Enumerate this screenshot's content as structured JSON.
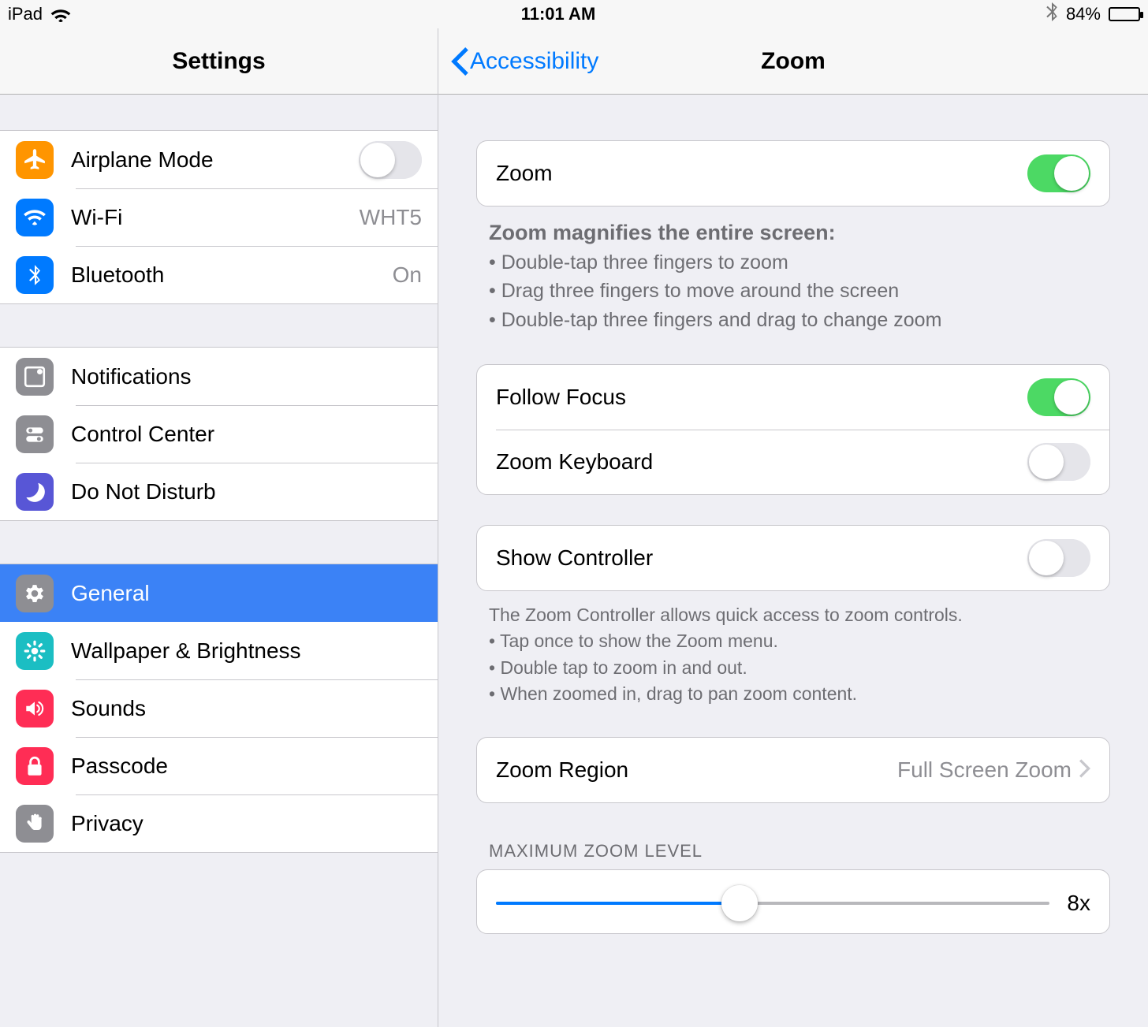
{
  "status": {
    "device": "iPad",
    "time": "11:01 AM",
    "battery_pct": "84%",
    "battery_fill": 84
  },
  "sidebar": {
    "title": "Settings",
    "groups": [
      [
        {
          "id": "airplane",
          "label": "Airplane Mode",
          "icon": "airplane-icon",
          "iconClass": "ic-airplane",
          "control": "toggle",
          "value": false
        },
        {
          "id": "wifi",
          "label": "Wi-Fi",
          "icon": "wifi-icon",
          "iconClass": "ic-wifi",
          "control": "value",
          "value": "WHT5"
        },
        {
          "id": "bluetooth",
          "label": "Bluetooth",
          "icon": "bluetooth-icon",
          "iconClass": "ic-bluetooth",
          "control": "value",
          "value": "On"
        }
      ],
      [
        {
          "id": "notifications",
          "label": "Notifications",
          "icon": "notifications-icon",
          "iconClass": "ic-notif"
        },
        {
          "id": "controlcenter",
          "label": "Control Center",
          "icon": "control-center-icon",
          "iconClass": "ic-control"
        },
        {
          "id": "dnd",
          "label": "Do Not Disturb",
          "icon": "moon-icon",
          "iconClass": "ic-dnd"
        }
      ],
      [
        {
          "id": "general",
          "label": "General",
          "icon": "gear-icon",
          "iconClass": "ic-general",
          "selected": true
        },
        {
          "id": "wallpaper",
          "label": "Wallpaper & Brightness",
          "icon": "rosette-icon",
          "iconClass": "ic-wallpaper"
        },
        {
          "id": "sounds",
          "label": "Sounds",
          "icon": "speaker-icon",
          "iconClass": "ic-sounds"
        },
        {
          "id": "passcode",
          "label": "Passcode",
          "icon": "lock-icon",
          "iconClass": "ic-passcode"
        },
        {
          "id": "privacy",
          "label": "Privacy",
          "icon": "hand-icon",
          "iconClass": "ic-privacy"
        }
      ]
    ]
  },
  "detail": {
    "back_label": "Accessibility",
    "title": "Zoom",
    "sections": {
      "zoom_toggle": {
        "label": "Zoom",
        "value": true
      },
      "zoom_desc": {
        "heading": "Zoom magnifies the entire screen:",
        "bullets": [
          "Double-tap three fingers to zoom",
          "Drag three fingers to move around the screen",
          "Double-tap three fingers and drag to change zoom"
        ]
      },
      "follow_focus": {
        "label": "Follow Focus",
        "value": true
      },
      "zoom_keyboard": {
        "label": "Zoom Keyboard",
        "value": false
      },
      "show_controller": {
        "label": "Show Controller",
        "value": false
      },
      "controller_desc": {
        "lead": "The Zoom Controller allows quick access to zoom controls.",
        "bullets": [
          "Tap once to show the Zoom menu.",
          "Double tap to zoom in and out.",
          "When zoomed in, drag to pan zoom content."
        ]
      },
      "zoom_region": {
        "label": "Zoom Region",
        "value": "Full Screen Zoom"
      },
      "max_level": {
        "header": "MAXIMUM ZOOM LEVEL",
        "value_label": "8x",
        "percent": 44
      }
    }
  }
}
